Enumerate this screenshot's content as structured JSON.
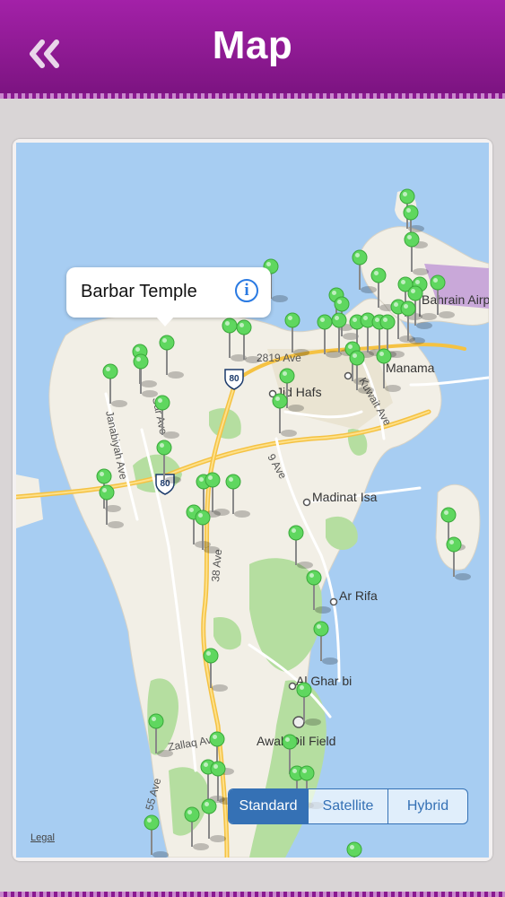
{
  "header": {
    "title": "Map",
    "back_icon": "double-chevron-left-icon"
  },
  "callout": {
    "title": "Barbar Temple",
    "info_icon": "info-icon",
    "info_symbol": "i"
  },
  "map": {
    "places": [
      {
        "name": "Manama"
      },
      {
        "name": "Jid Hafs"
      },
      {
        "name": "Madinat Isa"
      },
      {
        "name": "Ar Rifa"
      },
      {
        "name": "Al Ghar bi"
      },
      {
        "name": "Awali Oil Field"
      },
      {
        "name": "Bahrain Airport (BAH)"
      }
    ],
    "roads": [
      {
        "name": "2819 Ave"
      },
      {
        "name": "Janabiyah Ave"
      },
      {
        "name": "Sar Ave"
      },
      {
        "name": "38 Ave"
      },
      {
        "name": "Zallaq Ave"
      },
      {
        "name": "55 Ave"
      },
      {
        "name": "Kuwait Ave"
      },
      {
        "name": "9 Ave"
      }
    ],
    "shields": [
      "80",
      "80"
    ],
    "pin_color": "#5fd75f",
    "water_color": "#a7cdf2",
    "land_color": "#f2efe6",
    "park_color": "#b5dea0"
  },
  "map_types": {
    "options": [
      "Standard",
      "Satellite",
      "Hybrid"
    ],
    "selected": "Standard"
  },
  "legal": "Legal"
}
